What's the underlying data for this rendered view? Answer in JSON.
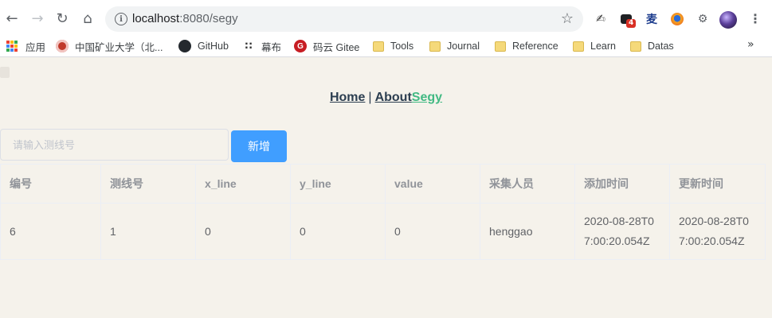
{
  "browser": {
    "url_host": "localhost",
    "url_path": ":8080/segy",
    "bookmarks": [
      {
        "label": "应用",
        "icon": "apps-grid-icon"
      },
      {
        "label": "中国矿业大学（北...",
        "icon": "university-icon"
      },
      {
        "label": "GitHub",
        "icon": "github-icon"
      },
      {
        "label": "幕布",
        "icon": "mubu-icon"
      },
      {
        "label": "码云 Gitee",
        "icon": "gitee-icon"
      },
      {
        "label": "Tools",
        "icon": "folder-icon"
      },
      {
        "label": "Journal",
        "icon": "folder-icon"
      },
      {
        "label": "Reference",
        "icon": "folder-icon"
      },
      {
        "label": "Learn",
        "icon": "folder-icon"
      },
      {
        "label": "Datas",
        "icon": "folder-icon"
      }
    ],
    "extension_badge": "4",
    "bookmarks_more": "»"
  },
  "nav": {
    "home": "Home",
    "separator": "|",
    "about": "About",
    "segy": "Segy"
  },
  "search": {
    "placeholder": "请输入测线号",
    "value": ""
  },
  "add_button_label": "新增",
  "table": {
    "columns": [
      "编号",
      "测线号",
      "x_line",
      "y_line",
      "value",
      "采集人员",
      "添加时间",
      "更新时间"
    ],
    "rows": [
      [
        "6",
        "1",
        "0",
        "0",
        "0",
        "henggao",
        "2020-08-28T07:00:20.054Z",
        "2020-08-28T07:00:20.054Z"
      ]
    ]
  },
  "colors": {
    "accent_blue": "#409eff",
    "router_active_green": "#42b983",
    "nav_text": "#2c3e50",
    "page_background": "#f5f2eb"
  }
}
